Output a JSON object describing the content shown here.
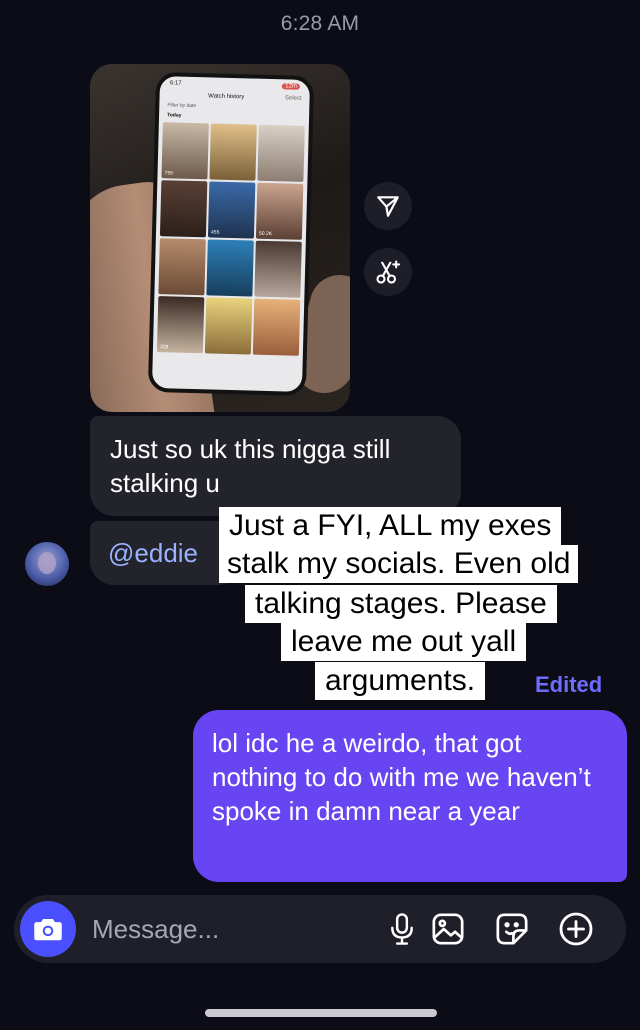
{
  "header": {
    "timestamp": "6:28 AM"
  },
  "shared_photo": {
    "phone_status_time": "6:17",
    "phone_status_pill": "12m",
    "screen_title": "Watch history",
    "select_label": "Select",
    "filter_label": "Filter by date",
    "section_label": "Today",
    "tile_views": [
      "755",
      "",
      "",
      "",
      "455",
      "50.2K",
      "",
      "",
      "",
      "328",
      "",
      ""
    ]
  },
  "side_actions": [
    {
      "icon": "send-icon"
    },
    {
      "icon": "remix-icon"
    }
  ],
  "messages": [
    {
      "direction": "incoming",
      "text": "Just so uk this nigga still stalking u"
    },
    {
      "direction": "incoming",
      "text": "@eddie"
    }
  ],
  "caption_overlay": {
    "lines": [
      "Just a FYI, ALL my exes",
      "stalk my socials. Even old",
      "talking stages. Please",
      "leave me out yall",
      "arguments."
    ],
    "edited_label": "Edited"
  },
  "outgoing_message": {
    "text": "lol idc he a weirdo, that got nothing to do with me we haven’t spoke in damn near a year"
  },
  "composer": {
    "placeholder": "Message...",
    "icons": [
      "camera-icon",
      "microphone-icon",
      "gallery-icon",
      "sticker-icon",
      "add-icon"
    ]
  },
  "colors": {
    "background": "#0b0c15",
    "incoming_bubble": "#23242b",
    "outgoing_bubble": "#6845f2",
    "mention": "#9ab1ff",
    "edited": "#6e6cff",
    "camera_button": "#4a50ff"
  }
}
